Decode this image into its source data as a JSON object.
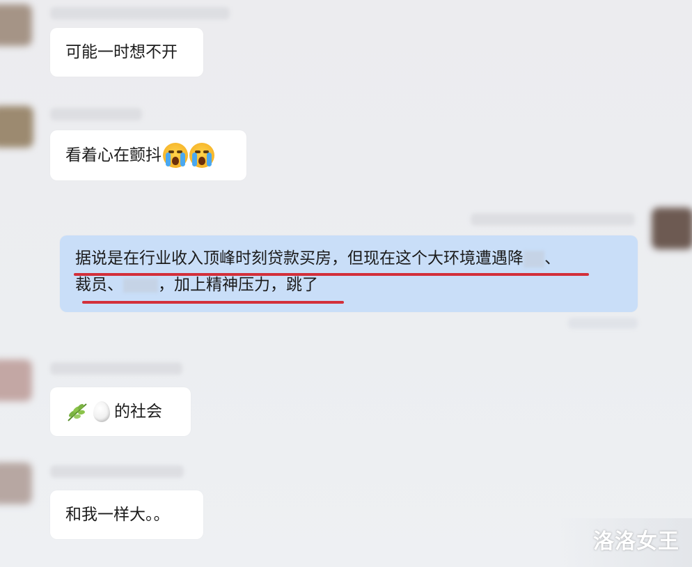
{
  "messages": [
    {
      "text": "可能一时想不开"
    },
    {
      "text": "看着心在颤抖",
      "emoji": [
        "crying-face",
        "crying-face"
      ]
    },
    {
      "line1": "据说是在行业收入顶峰时刻贷款买房，但现在这个大环境遭遇降",
      "line1_end": "、",
      "line2_start": "裁员、",
      "line2": "，加上精神压力，跳了"
    },
    {
      "text": "的社会",
      "emoji": [
        "herb-icon",
        "egg-icon"
      ]
    },
    {
      "text": "和我一样大。。"
    }
  ],
  "watermark": "洛洛女王",
  "colors": {
    "incoming_bubble": "#ffffff",
    "outgoing_bubble": "#c9def8",
    "underline": "#d32f3a",
    "background": "#ebedf0"
  }
}
